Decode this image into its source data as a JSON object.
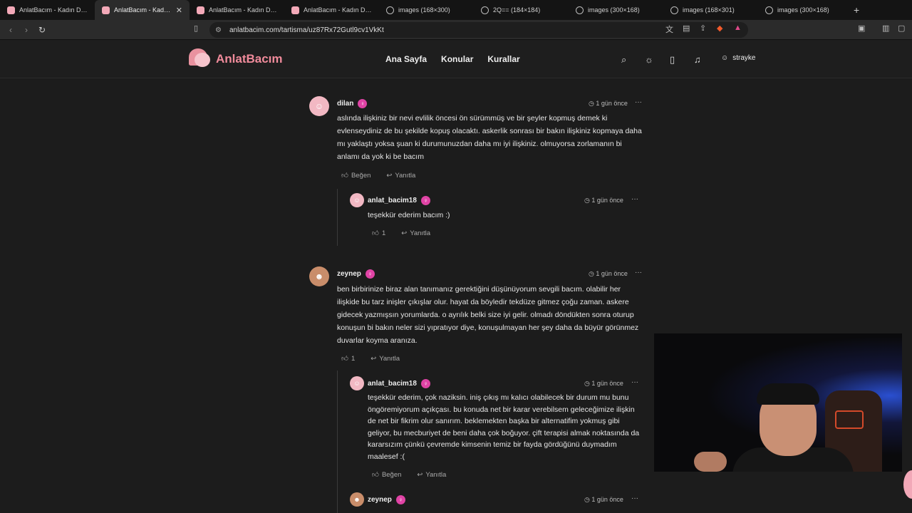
{
  "browser": {
    "tabs": [
      {
        "title": "AnlatBacım - Kadın Destek",
        "icon": "site-favicon",
        "active": false
      },
      {
        "title": "AnlatBacım - Kadın De",
        "icon": "site-favicon",
        "active": true
      },
      {
        "title": "AnlatBacım - Kadın Destek",
        "icon": "site-favicon",
        "active": false
      },
      {
        "title": "AnlatBacım - Kadın Destek",
        "icon": "site-favicon",
        "active": false
      },
      {
        "title": "images (168×300)",
        "icon": "globe-icon",
        "active": false
      },
      {
        "title": "2Q== (184×184)",
        "icon": "globe-icon",
        "active": false
      },
      {
        "title": "images (300×168)",
        "icon": "globe-icon",
        "active": false
      },
      {
        "title": "images (168×301)",
        "icon": "globe-icon",
        "active": false
      },
      {
        "title": "images (300×168)",
        "icon": "globe-icon",
        "active": false
      }
    ],
    "new_tab_label": "+",
    "url": "anlatbacim.com/tartisma/uz87Rx72Gutl9cv1VkKt"
  },
  "site": {
    "logo_text": "AnlatBacım",
    "nav": [
      "Ana Sayfa",
      "Konular",
      "Kurallar"
    ],
    "username": "strayke"
  },
  "comments": [
    {
      "author": "dilan",
      "time": "1 gün önce",
      "text": "aslında ilişkiniz bir nevi evlilik öncesi ön sürümmüş ve bir şeyler kopmuş demek ki evlenseydiniz de bu şekilde kopuş olacaktı. askerlik sonrası bir bakın ilişkiniz kopmaya daha mı yaklaştı yoksa şuan ki durumunuzdan daha mı iyi ilişkiniz. olmuyorsa zorlamanın bi anlamı da yok ki be bacım",
      "like_label": "Beğen",
      "reply_label": "Yanıtla"
    },
    {
      "author": "anlat_bacim18",
      "time": "1 gün önce",
      "text": "teşekkür ederim bacım :)",
      "like_label": "1",
      "reply_label": "Yanıtla"
    },
    {
      "author": "zeynep",
      "time": "1 gün önce",
      "text": "ben birbirinize biraz alan tanımanız gerektiğini düşünüyorum sevgili bacım. olabilir her ilişkide bu tarz inişler çıkışlar olur. hayat da böyledir tekdüze gitmez çoğu zaman. askere gidecek yazmışsın yorumlarda. o ayrılık belki size iyi gelir. olmadı döndükten sonra oturup konuşun bi bakın neler sizi yıpratıyor diye, konuşulmayan her şey daha da büyür görünmez duvarlar koyma aranıza.",
      "like_label": "1",
      "reply_label": "Yanıtla"
    },
    {
      "author": "anlat_bacim18",
      "time": "1 gün önce",
      "text": "teşekkür ederim, çok naziksin. iniş çıkış mı kalıcı olabilecek bir durum mu bunu öngöremiyorum açıkçası. bu konuda net bir karar verebilsem geleceğimize ilişkin de net bir fikrim olur sanırım. beklemekten başka bir alternatifim yokmuş gibi geliyor, bu mecburiyet de beni daha çok boğuyor. çift terapisi almak noktasında da kararsızım çünkü çevremde kimsenin temiz bir fayda gördüğünü duymadım maalesef :(",
      "like_label": "Beğen",
      "reply_label": "Yanıtla"
    },
    {
      "author": "zeynep",
      "time": "1 gün önce"
    }
  ]
}
